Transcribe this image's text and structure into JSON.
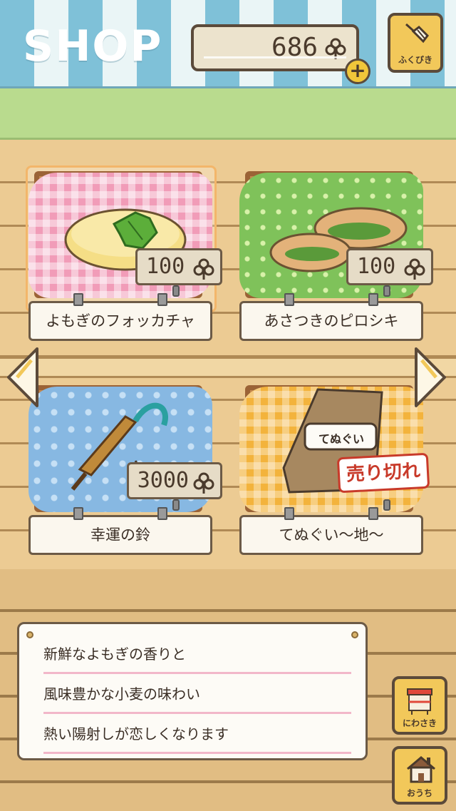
{
  "header": {
    "title": "SHOP",
    "coins": "686",
    "currency_icon": "clover-icon",
    "lottery_label": "ふくびき"
  },
  "items": [
    {
      "name": "よもぎのフォッカチャ",
      "price": "100",
      "cloth": "pink",
      "selected": true,
      "sold_out": false
    },
    {
      "name": "あさつきのピロシキ",
      "price": "100",
      "cloth": "green",
      "selected": false,
      "sold_out": false
    },
    {
      "name": "幸運の鈴",
      "price": "3000",
      "cloth": "blue",
      "selected": false,
      "sold_out": false
    },
    {
      "name": "てぬぐい〜地〜",
      "price": "",
      "cloth": "yellow",
      "selected": false,
      "sold_out": true,
      "sold_out_label": "売り切れ",
      "towel_label": "てぬぐい"
    }
  ],
  "description": {
    "lines": [
      "新鮮なよもぎの香りと",
      "風味豊かな小麦の味わい",
      "熱い陽射しが恋しくなります"
    ]
  },
  "side_buttons": {
    "garden_label": "にわさき",
    "home_label": "おうち"
  },
  "colors": {
    "awning_blue": "#7fc1d8",
    "grass": "#b9db8e",
    "wood": "#eccb93",
    "button_yellow": "#f2c85a",
    "outline": "#5b4a3a"
  }
}
